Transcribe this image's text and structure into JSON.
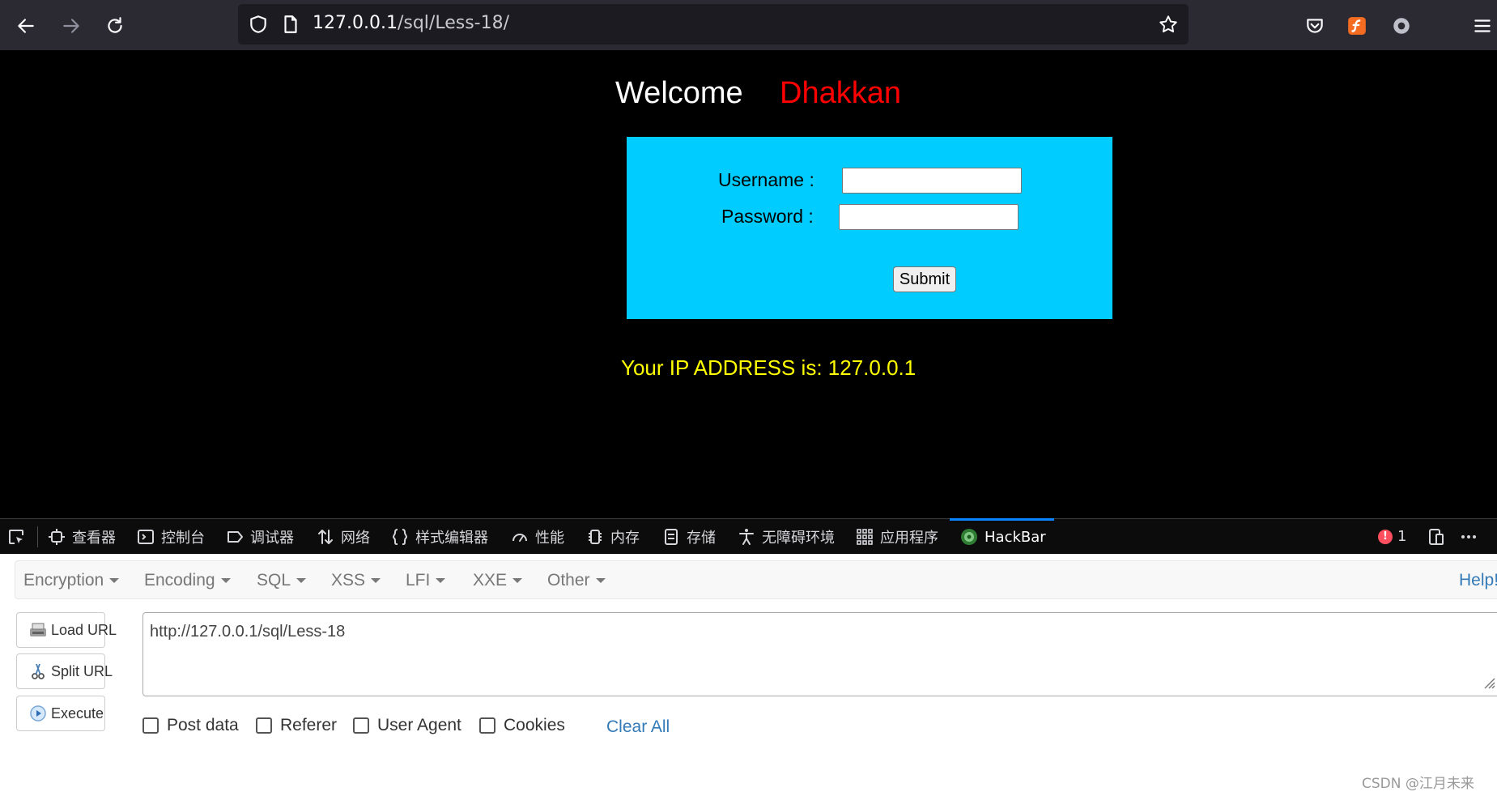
{
  "browser": {
    "url_host": "127.0.0.1",
    "url_path": "/sql/Less-18/"
  },
  "page": {
    "welcome": "Welcome",
    "name": "Dhakkan",
    "username_label": "Username :",
    "password_label": "Password :",
    "username_value": "",
    "password_value": "",
    "submit_label": "Submit",
    "ip_message": "Your IP ADDRESS is: 127.0.0.1",
    "colors": {
      "form_bg": "#00ccff",
      "name": "#ff0000",
      "ip": "#ffff00"
    }
  },
  "devtools": {
    "tabs": [
      {
        "label": "查看器",
        "icon": "inspector-icon"
      },
      {
        "label": "控制台",
        "icon": "console-icon"
      },
      {
        "label": "调试器",
        "icon": "debugger-icon"
      },
      {
        "label": "网络",
        "icon": "network-icon"
      },
      {
        "label": "样式编辑器",
        "icon": "style-editor-icon"
      },
      {
        "label": "性能",
        "icon": "performance-icon"
      },
      {
        "label": "内存",
        "icon": "memory-icon"
      },
      {
        "label": "存储",
        "icon": "storage-icon"
      },
      {
        "label": "无障碍环境",
        "icon": "accessibility-icon"
      },
      {
        "label": "应用程序",
        "icon": "application-icon"
      },
      {
        "label": "HackBar",
        "icon": "hackbar-icon"
      }
    ],
    "active_tab": "HackBar",
    "error_count": "1"
  },
  "hackbar": {
    "menu": [
      "Encryption",
      "Encoding",
      "SQL",
      "XSS",
      "LFI",
      "XXE",
      "Other"
    ],
    "help": "Help!",
    "buttons": {
      "load": "Load URL",
      "split": "Split URL",
      "execute": "Execute"
    },
    "url_value": "http://127.0.0.1/sql/Less-18",
    "checks": [
      "Post data",
      "Referer",
      "User Agent",
      "Cookies"
    ],
    "clear_all": "Clear All"
  },
  "watermark": "CSDN @江月未来"
}
